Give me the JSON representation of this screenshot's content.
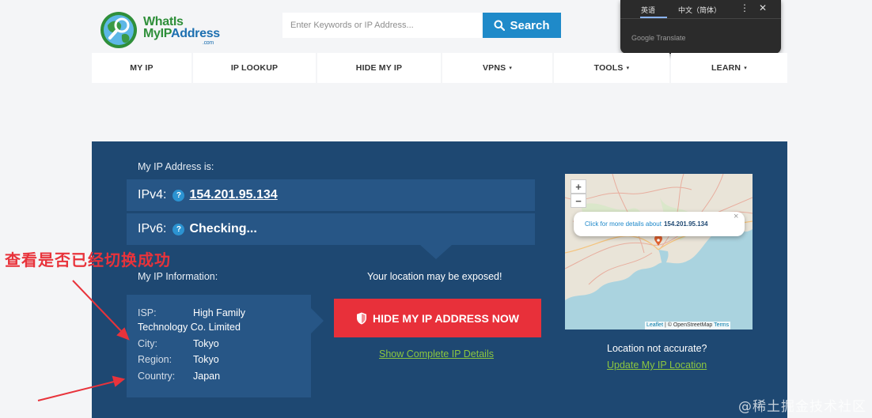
{
  "header": {
    "logo_line1": "WhatIs",
    "logo_line2_a": "MyIP",
    "logo_line2_b": "Address",
    "logo_com": ".com",
    "search_placeholder": "Enter Keywords or IP Address...",
    "search_label": "Search"
  },
  "translate_popup": {
    "tab_english": "英语",
    "tab_chinese": "中文（简体）",
    "brand": "Google Translate",
    "more_icon": "more-vert-icon",
    "close_icon": "close-icon"
  },
  "nav": {
    "items": [
      {
        "label": "MY IP",
        "dropdown": false
      },
      {
        "label": "IP LOOKUP",
        "dropdown": false
      },
      {
        "label": "HIDE MY IP",
        "dropdown": false
      },
      {
        "label": "VPNS",
        "dropdown": true
      },
      {
        "label": "TOOLS",
        "dropdown": true
      },
      {
        "label": "LEARN",
        "dropdown": true
      }
    ],
    "caret": "▾"
  },
  "main": {
    "ip_heading": "My IP Address is:",
    "ipv4_label": "IPv4:",
    "ipv4_value": "154.201.95.134",
    "ipv6_label": "IPv6:",
    "ipv6_value": "Checking...",
    "help_icon": "?",
    "info_heading": "My IP Information:",
    "info": {
      "isp_key": "ISP:",
      "isp_value_line1": "High Family",
      "isp_value_line2": "Technology Co. Limited",
      "city_key": "City:",
      "city_value": "Tokyo",
      "region_key": "Region:",
      "region_value": "Tokyo",
      "country_key": "Country:",
      "country_value": "Japan"
    },
    "exposed_text": "Your location may be exposed!",
    "hide_button": "HIDE MY IP ADDRESS NOW",
    "details_link": "Show Complete IP Details",
    "accent_red": "#e8303a",
    "accent_green": "#8cc63f",
    "panel_color": "#1e4872"
  },
  "map": {
    "zoom_in": "+",
    "zoom_out": "−",
    "popup_text": "Click for more details about",
    "popup_ip": "154.201.95.134",
    "popup_close": "×",
    "attrib_leaflet": "Leaflet",
    "attrib_mid": " | © OpenStreetMap ",
    "attrib_terms": "Terms",
    "not_accurate": "Location not accurate?",
    "update_link": "Update My IP Location"
  },
  "annotation": {
    "text": "查看是否已经切换成功",
    "color": "#e8333b"
  },
  "watermark": "@稀土掘金技术社区"
}
